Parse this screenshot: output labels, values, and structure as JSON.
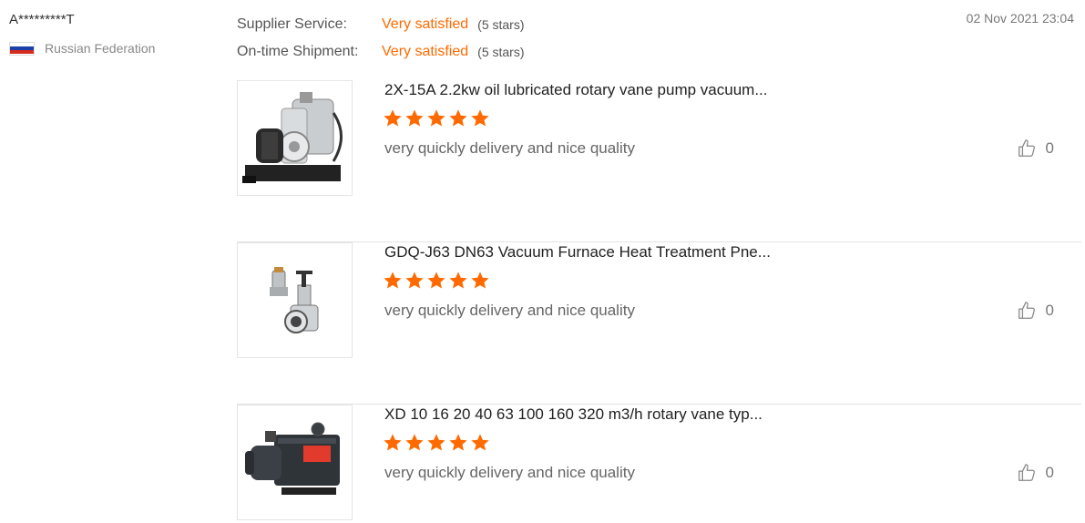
{
  "reviewer": {
    "name": "A*********T",
    "country": "Russian Federation"
  },
  "ratings": [
    {
      "label": "Supplier Service:",
      "value": "Very satisfied",
      "stars": "(5 stars)"
    },
    {
      "label": "On-time Shipment:",
      "value": "Very satisfied",
      "stars": "(5 stars)"
    }
  ],
  "date": "02 Nov 2021 23:04",
  "colors": {
    "accent": "#ff6a00",
    "star": "#ff6a00"
  },
  "products": [
    {
      "title": "2X-15A 2.2kw oil lubricated rotary vane pump vacuum...",
      "rating": 5,
      "comment": "very quickly delivery and nice quality",
      "likes": "0",
      "thumbnail_icon": "rotary-vane-pump-image"
    },
    {
      "title": "GDQ-J63 DN63 Vacuum Furnace Heat Treatment Pne...",
      "rating": 5,
      "comment": "very quickly delivery and nice quality",
      "likes": "0",
      "thumbnail_icon": "vacuum-valve-image"
    },
    {
      "title": "XD 10 16 20 40 63 100 160 320 m3/h rotary vane typ...",
      "rating": 5,
      "comment": "very quickly delivery and nice quality",
      "likes": "0",
      "thumbnail_icon": "vacuum-pump-image"
    }
  ]
}
